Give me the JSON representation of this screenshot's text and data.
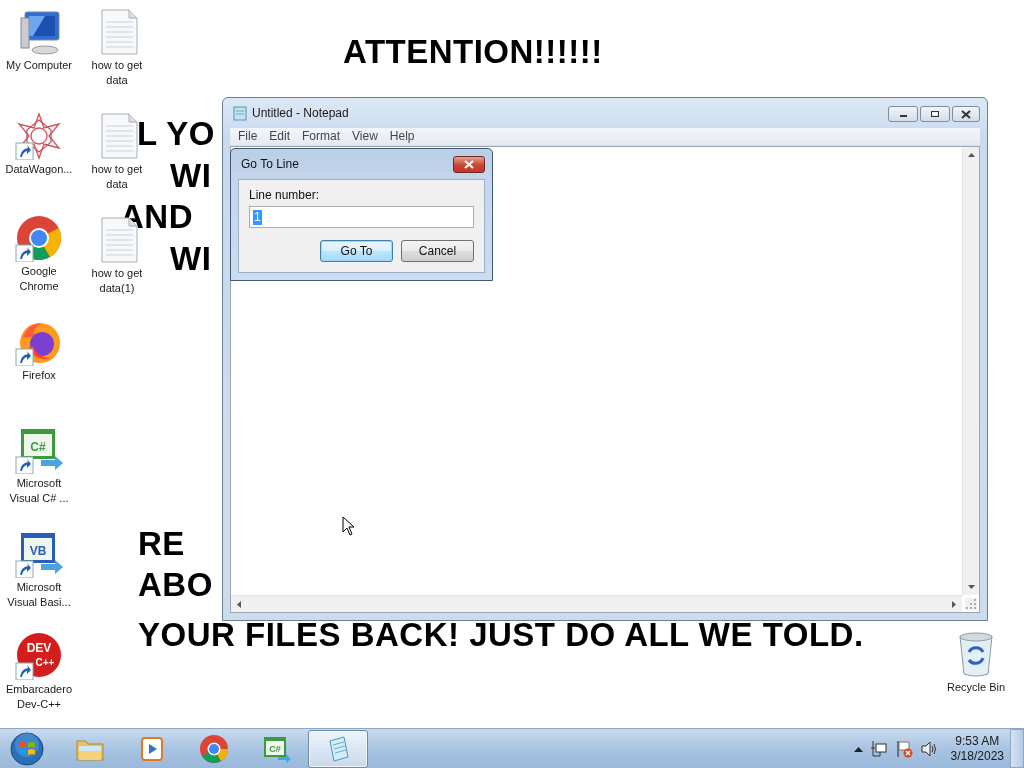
{
  "desktop": {
    "wallpaper_lines": [
      {
        "text": "ATTENTION!!!!!!"
      },
      {
        "text": "L YO"
      },
      {
        "text": "WI"
      },
      {
        "text": "AND"
      },
      {
        "text": "WI"
      },
      {
        "text": "RE"
      },
      {
        "text": "ABO"
      },
      {
        "text": "YOUR FILES BACK! JUST DO ALL WE TOLD."
      }
    ],
    "icons": [
      {
        "label": "My Computer",
        "kind": "computer",
        "shortcut": false
      },
      {
        "label": "DataWagon...",
        "kind": "star",
        "shortcut": true
      },
      {
        "label": "Google Chrome",
        "kind": "ring",
        "shortcut": true
      },
      {
        "label": "Firefox",
        "kind": "fox",
        "shortcut": true
      },
      {
        "label": "Microsoft Visual C# ...",
        "kind": "code",
        "badge": "C#",
        "shortcut": true
      },
      {
        "label": "Microsoft Visual Basi...",
        "kind": "code",
        "badge": "VB",
        "shortcut": true
      },
      {
        "label": "Embarcadero Dev-C++",
        "kind": "dev",
        "badge": "DEV",
        "badge2": "C++",
        "shortcut": true
      },
      {
        "label": "how to get data",
        "kind": "document",
        "shortcut": false
      },
      {
        "label": "how to get data",
        "kind": "document",
        "shortcut": false
      },
      {
        "label": "how to get data(1)",
        "kind": "document",
        "shortcut": false
      },
      {
        "label": "Recycle Bin",
        "kind": "bin",
        "shortcut": false
      }
    ]
  },
  "notepad": {
    "title": "Untitled - Notepad",
    "menu": [
      "File",
      "Edit",
      "Format",
      "View",
      "Help"
    ]
  },
  "dialog": {
    "title": "Go To Line",
    "label": "Line number:",
    "value": "1",
    "value_selected": true,
    "buttons": [
      {
        "label": "Go To",
        "default": true
      },
      {
        "label": "Cancel",
        "default": false
      }
    ]
  },
  "taskbar": {
    "apps": [
      {
        "kind": "folder",
        "selected": false
      },
      {
        "kind": "player",
        "selected": false
      },
      {
        "kind": "ring",
        "selected": false
      },
      {
        "kind": "code",
        "badge": "C#",
        "selected": false
      },
      {
        "kind": "notepad",
        "selected": true
      }
    ],
    "clock": {
      "time": "9:53 AM",
      "date": "3/18/2023"
    }
  }
}
